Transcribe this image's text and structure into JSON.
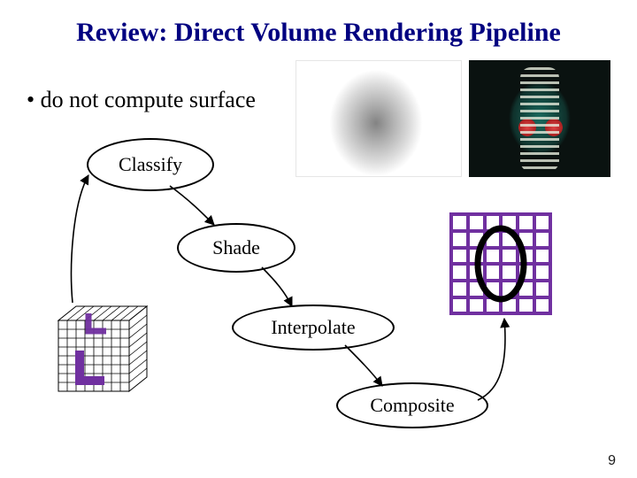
{
  "title": "Review: Direct Volume Rendering Pipeline",
  "bullet": "do not compute surface",
  "nodes": {
    "classify": "Classify",
    "shade": "Shade",
    "interpolate": "Interpolate",
    "composite": "Composite"
  },
  "page_number": "9",
  "colors": {
    "title": "#000080",
    "accent": "#7030A0"
  }
}
